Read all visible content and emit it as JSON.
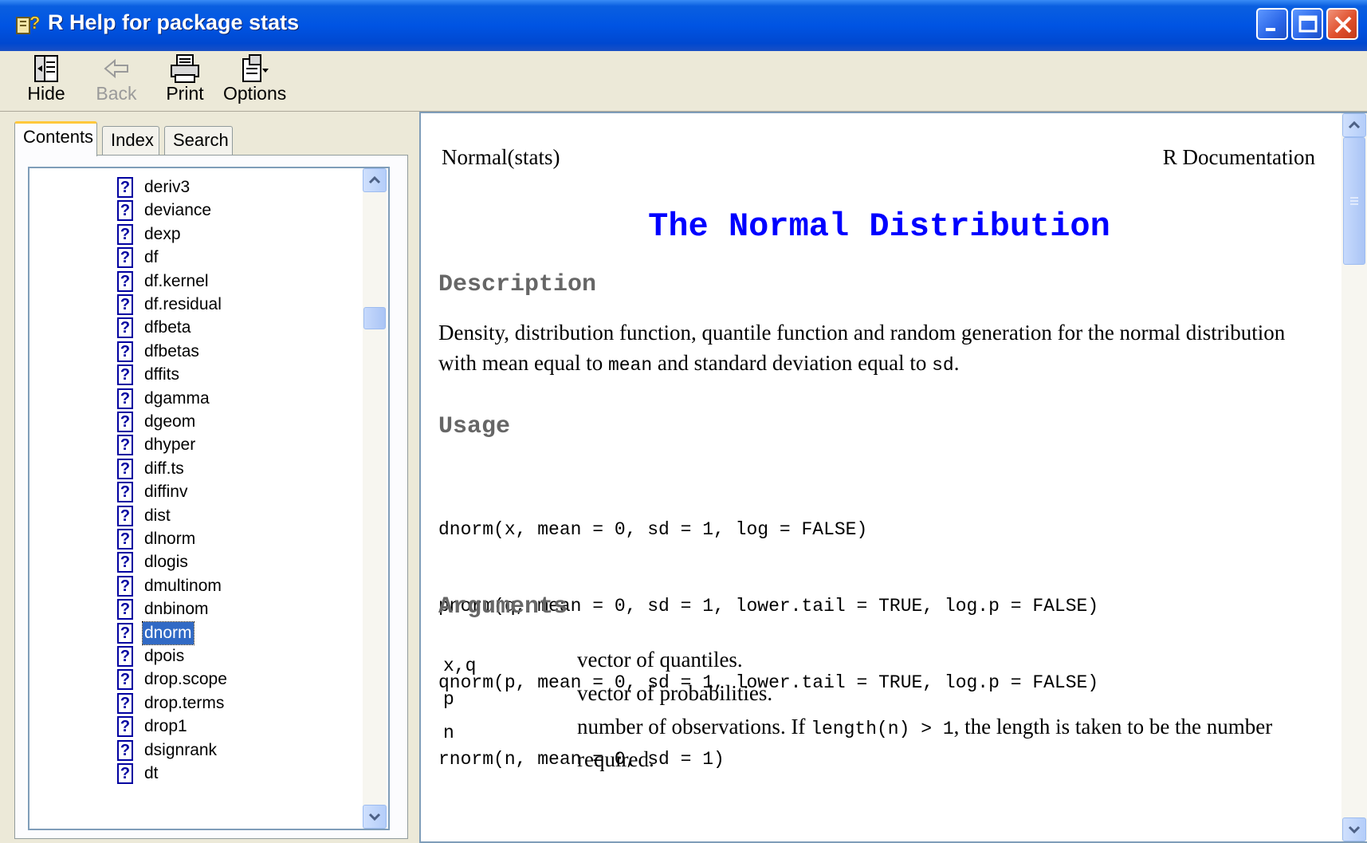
{
  "window": {
    "title": "R Help for package stats",
    "colors": {
      "titlebar": "#0054e3",
      "close": "#e0502c"
    }
  },
  "toolbar": {
    "hide_label": "Hide",
    "back_label": "Back",
    "print_label": "Print",
    "options_label": "Options"
  },
  "tabs": {
    "contents": "Contents",
    "index": "Index",
    "search": "Search"
  },
  "tree": {
    "items": [
      "deriv3",
      "deviance",
      "dexp",
      "df",
      "df.kernel",
      "df.residual",
      "dfbeta",
      "dfbetas",
      "dffits",
      "dgamma",
      "dgeom",
      "dhyper",
      "diff.ts",
      "diffinv",
      "dist",
      "dlnorm",
      "dlogis",
      "dmultinom",
      "dnbinom",
      "dnorm",
      "dpois",
      "drop.scope",
      "drop.terms",
      "drop1",
      "dsignrank",
      "dt"
    ],
    "item_icon": "help-topic-icon",
    "icon_glyph": "?",
    "selected": "dnorm"
  },
  "doc": {
    "header_left": "Normal(stats)",
    "header_right": "R Documentation",
    "title": "The Normal Distribution",
    "description_heading": "Description",
    "description": {
      "text1": "Density, distribution function, quantile function and random generation for the normal distribution with mean equal to ",
      "code1": "mean",
      "text2": " and standard deviation equal to ",
      "code2": "sd",
      "text3": "."
    },
    "usage_heading": "Usage",
    "usage_lines": [
      "dnorm(x, mean = 0, sd = 1, log = FALSE)",
      "pnorm(q, mean = 0, sd = 1, lower.tail = TRUE, log.p = FALSE)",
      "qnorm(p, mean = 0, sd = 1, lower.tail = TRUE, log.p = FALSE)",
      "rnorm(n, mean = 0, sd = 1)"
    ],
    "arguments_heading": "Arguments",
    "arguments": [
      {
        "name": "x,q",
        "desc": "vector of quantiles."
      },
      {
        "name": "p",
        "desc": "vector of probabilities."
      },
      {
        "name": "n",
        "desc_text1": "number of observations. If ",
        "desc_code": "length(n) > 1",
        "desc_text2": ", the length is taken to be the number required."
      }
    ]
  }
}
